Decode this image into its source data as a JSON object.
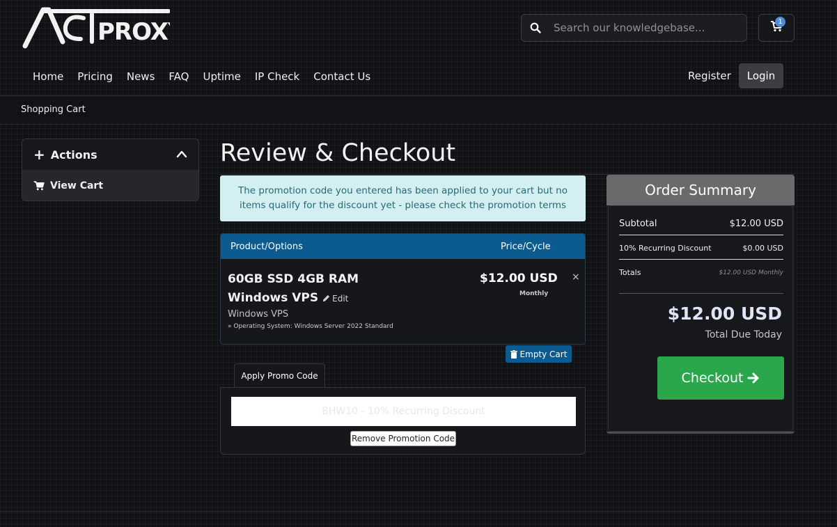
{
  "brand": {
    "logo_text": "ACTPROXY"
  },
  "search": {
    "placeholder": "Search our knowledgebase..."
  },
  "cart": {
    "count": "1"
  },
  "nav": {
    "items": [
      "Home",
      "Pricing",
      "News",
      "FAQ",
      "Uptime",
      "IP Check",
      "Contact Us"
    ],
    "register": "Register",
    "login": "Login"
  },
  "breadcrumb": {
    "current": "Shopping Cart"
  },
  "sidebar": {
    "title": "Actions",
    "items": [
      "View Cart"
    ]
  },
  "page": {
    "title": "Review & Checkout"
  },
  "alert": {
    "text": "The promotion code you entered has been applied to your cart but no items qualify for the discount yet - please check the promotion terms"
  },
  "table": {
    "col_product": "Product/Options",
    "col_price": "Price/Cycle",
    "item": {
      "name": "60GB SSD 4GB RAM Windows VPS",
      "edit": "Edit",
      "group": "Windows VPS",
      "option": "» Operating System: Windows Server 2022 Standard",
      "price": "$12.00 USD",
      "cycle": "Monthly",
      "remove": "×"
    }
  },
  "empty_cart": "Empty Cart",
  "promo": {
    "tab": "Apply Promo Code",
    "field_value": "BHW10 - 10% Recurring Discount",
    "remove": "Remove Promotion Code"
  },
  "summary": {
    "title": "Order Summary",
    "subtotal_label": "Subtotal",
    "subtotal_value": "$12.00 USD",
    "discount_label": "10% Recurring Discount",
    "discount_value": "$0.00 USD",
    "totals_label": "Totals",
    "totals_value": "$12.00 USD Monthly",
    "total_due": "$12.00 USD",
    "total_due_label": "Total Due Today",
    "checkout": "Checkout"
  },
  "colors": {
    "accent_blue": "#0b5b91",
    "checkout_green": "#2aa74a",
    "alert_bg": "#d3eff2"
  }
}
